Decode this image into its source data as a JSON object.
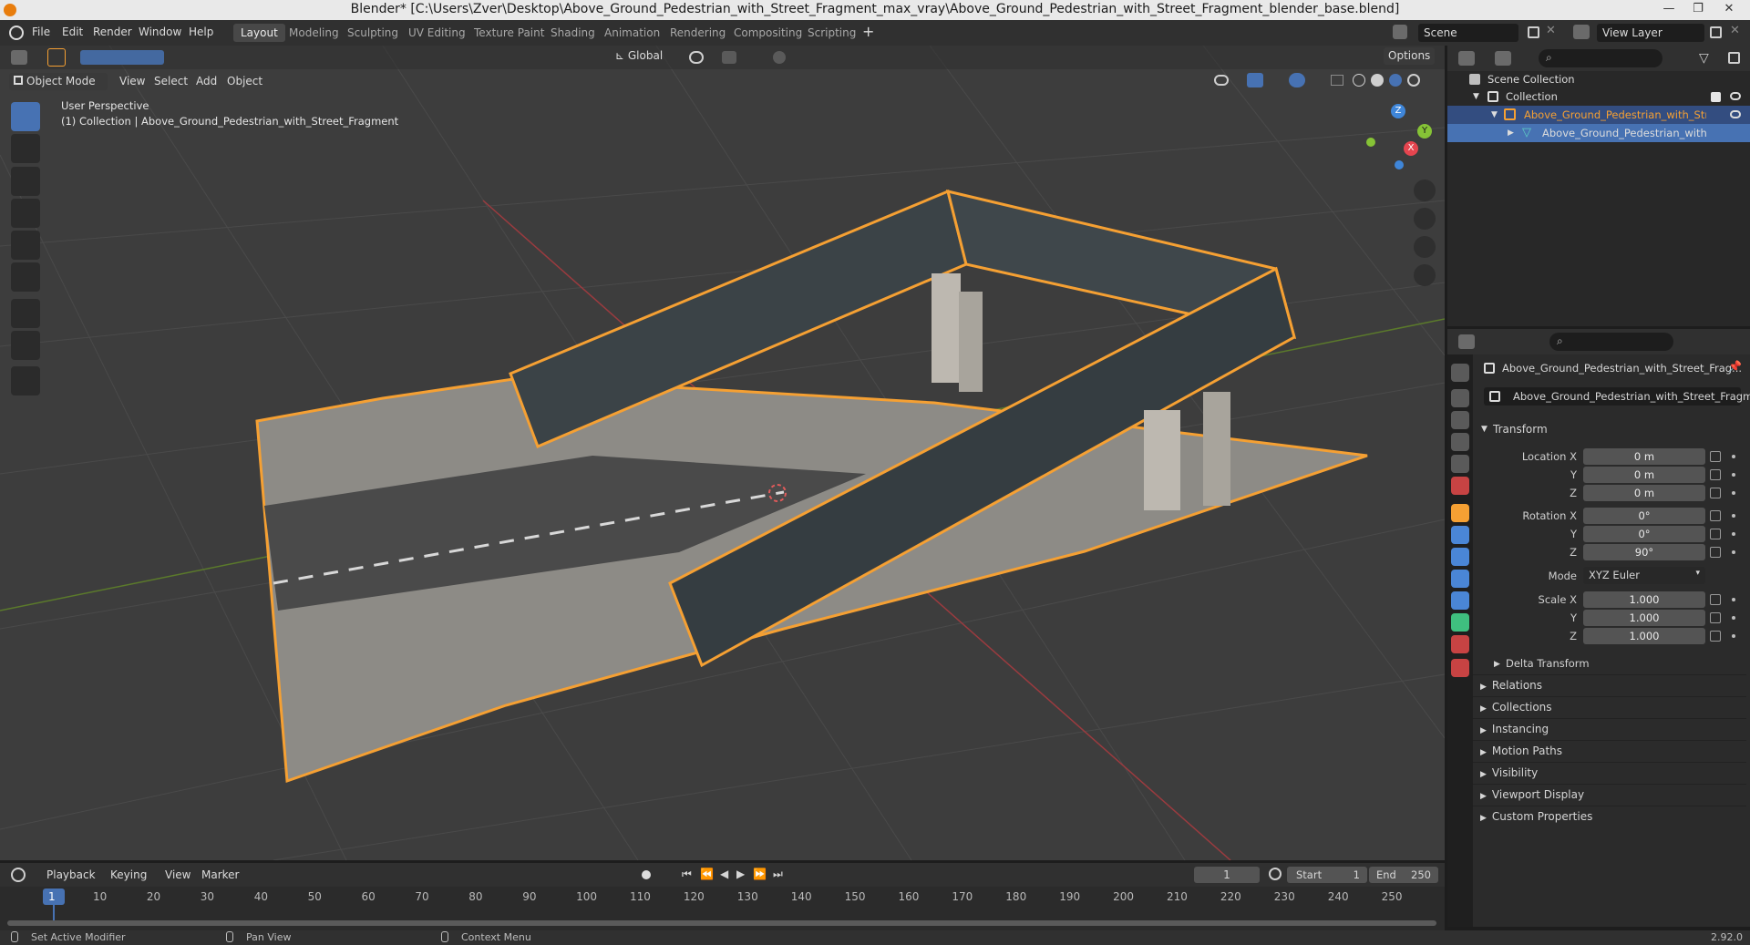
{
  "window": {
    "title": "Blender* [C:\\Users\\Zver\\Desktop\\Above_Ground_Pedestrian_with_Street_Fragment_max_vray\\Above_Ground_Pedestrian_with_Street_Fragment_blender_base.blend]",
    "controls": [
      "—",
      "❐",
      "✕"
    ]
  },
  "menu": [
    "File",
    "Edit",
    "Render",
    "Window",
    "Help"
  ],
  "workspaces": [
    "Layout",
    "Modeling",
    "Sculpting",
    "UV Editing",
    "Texture Paint",
    "Shading",
    "Animation",
    "Rendering",
    "Compositing",
    "Scripting"
  ],
  "active_workspace": "Layout",
  "add_workspace_glyph": "+",
  "scene": {
    "name": "Scene",
    "view_layer": "View Layer"
  },
  "viewport": {
    "mode": "Object Mode",
    "menus": [
      "View",
      "Select",
      "Add",
      "Object"
    ],
    "orientation": "Global",
    "options_label": "Options",
    "overlay_title": "User Perspective",
    "overlay_subtitle": "(1) Collection | Above_Ground_Pedestrian_with_Street_Fragment",
    "gizmo_axes": [
      "X",
      "Y",
      "Z"
    ]
  },
  "outliner": {
    "rows": [
      {
        "label": "Scene Collection",
        "kind": "scene"
      },
      {
        "label": "Collection",
        "kind": "collection"
      },
      {
        "label": "Above_Ground_Pedestrian_with_Street_F",
        "kind": "object"
      },
      {
        "label": "Above_Ground_Pedestrian_with_Stre",
        "kind": "mesh"
      }
    ]
  },
  "properties": {
    "object_name": "Above_Ground_Pedestrian_with_Street_Frag...",
    "datablock": "Above_Ground_Pedestrian_with_Street_Fragment",
    "transform_label": "Transform",
    "location": {
      "label": "Location X",
      "x": "0 m",
      "y": "0 m",
      "z": "0 m"
    },
    "rotation": {
      "label": "Rotation X",
      "x": "0°",
      "y": "0°",
      "z": "90°"
    },
    "mode": {
      "label": "Mode",
      "value": "XYZ Euler"
    },
    "scale": {
      "label": "Scale X",
      "x": "1.000",
      "y": "1.000",
      "z": "1.000"
    },
    "axis_y": "Y",
    "axis_z": "Z",
    "delta": "Delta Transform",
    "panels": [
      "Relations",
      "Collections",
      "Instancing",
      "Motion Paths",
      "Visibility",
      "Viewport Display",
      "Custom Properties"
    ]
  },
  "timeline": {
    "menus": [
      "Playback",
      "Keying",
      "View",
      "Marker"
    ],
    "current_frame": "1",
    "start_label": "Start",
    "start": "1",
    "end_label": "End",
    "end": "250",
    "ticks": [
      "1",
      "10",
      "20",
      "30",
      "40",
      "50",
      "60",
      "70",
      "80",
      "90",
      "100",
      "110",
      "120",
      "130",
      "140",
      "150",
      "160",
      "170",
      "180",
      "190",
      "200",
      "210",
      "220",
      "230",
      "240",
      "250"
    ]
  },
  "status": {
    "items": [
      "Set Active Modifier",
      "Pan View",
      "Context Menu"
    ],
    "version": "2.92.0"
  },
  "colors": {
    "accent": "#4772b3",
    "selection_outline": "#f5a033",
    "x_axis": "#e5454f",
    "y_axis": "#86c336",
    "z_axis": "#3f86d9"
  }
}
